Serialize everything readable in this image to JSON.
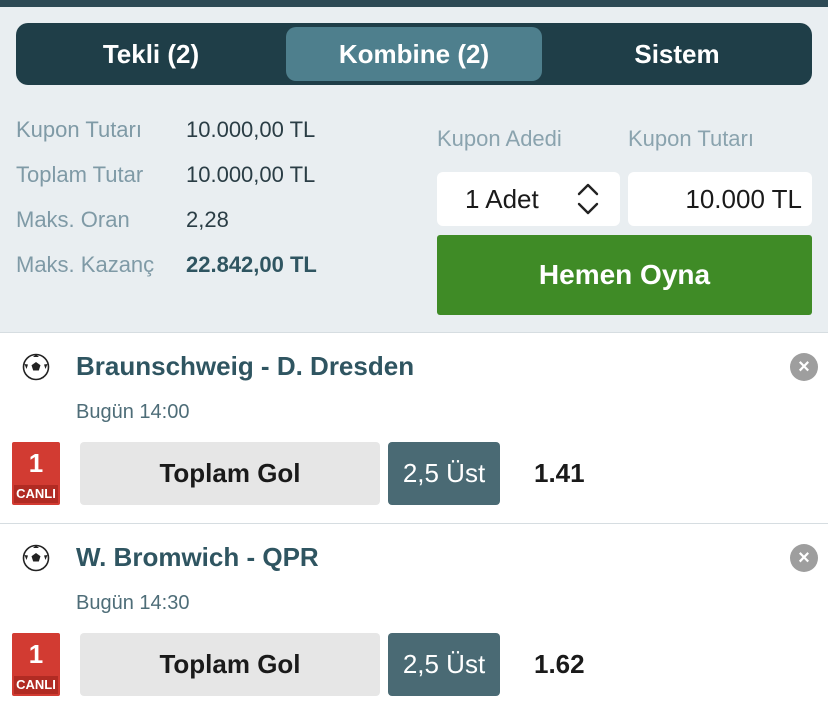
{
  "tabs": [
    {
      "label": "Tekli (2)"
    },
    {
      "label": "Kombine (2)",
      "active": true
    },
    {
      "label": "Sistem"
    }
  ],
  "summary": {
    "rows": [
      {
        "label": "Kupon Tutarı",
        "value": "10.000,00 TL"
      },
      {
        "label": "Toplam Tutar",
        "value": "10.000,00 TL"
      },
      {
        "label": "Maks. Oran",
        "value": "2,28"
      },
      {
        "label": "Maks. Kazanç",
        "value": "22.842,00 TL"
      }
    ]
  },
  "form": {
    "count_label": "Kupon Adedi",
    "count_value": "1 Adet",
    "amount_label": "Kupon Tutarı",
    "amount_value": "10.000 TL",
    "play_label": "Hemen Oyna"
  },
  "matches": [
    {
      "title": "Braunschweig - D. Dresden",
      "date": "Bugün 14:00",
      "live_number": "1",
      "live_label": "CANLI",
      "market": "Toplam Gol",
      "outcome": "2,5 Üst",
      "odds": "1.41"
    },
    {
      "title": "W. Bromwich - QPR",
      "date": "Bugün 14:30",
      "live_number": "1",
      "live_label": "CANLI",
      "market": "Toplam Gol",
      "outcome": "2,5 Üst",
      "odds": "1.62"
    }
  ],
  "colors": {
    "accent_dark": "#1f3e48",
    "tab_active": "#4e7f8d",
    "play_green": "#3f8b26",
    "live_red": "#d23b32"
  },
  "icons": {
    "ball": "soccer-ball-icon",
    "close": "close-circle-icon",
    "stepper": "chevron-up-down-icon"
  }
}
